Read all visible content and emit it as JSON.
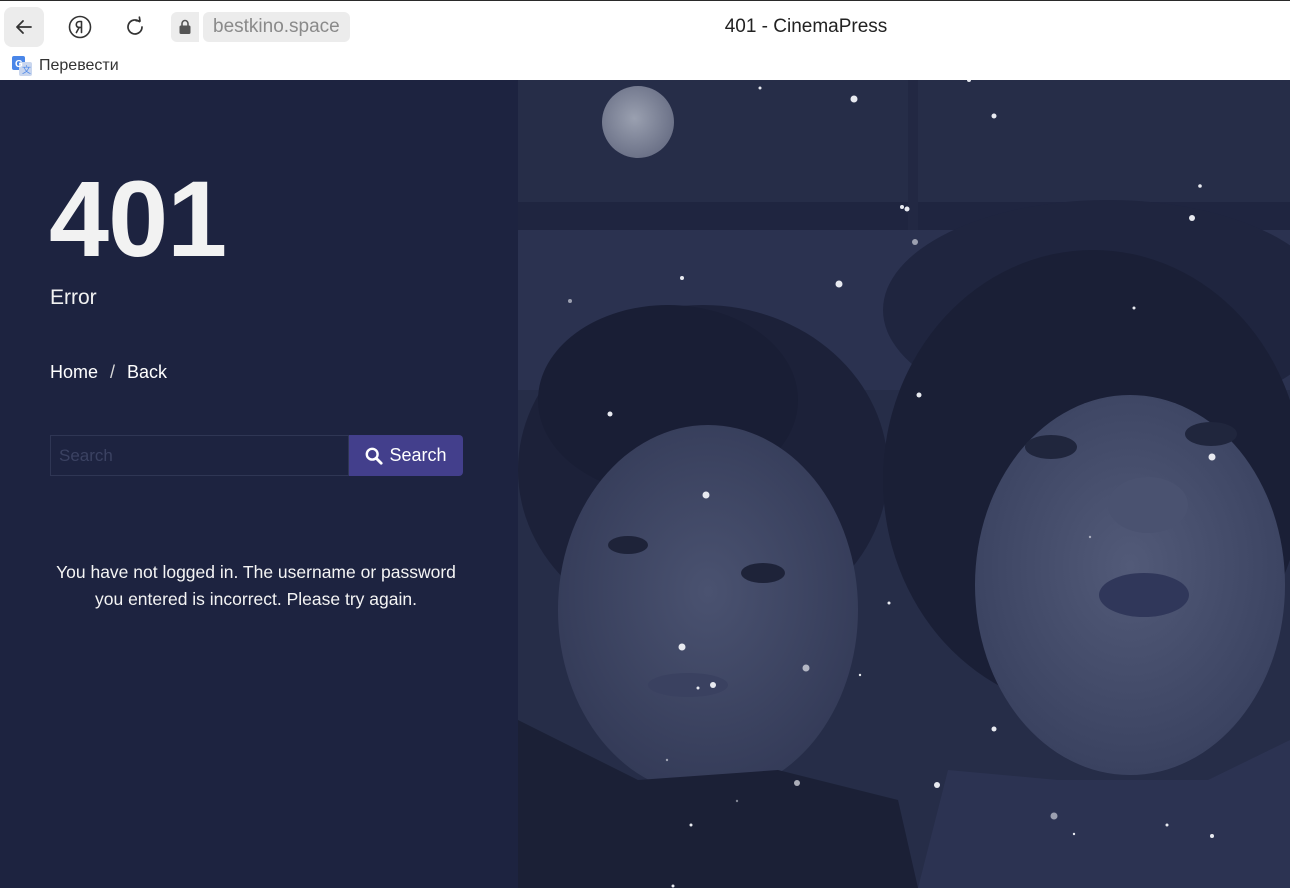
{
  "browser": {
    "url": "bestkino.space",
    "tab_title": "401 - CinemaPress",
    "translate_label": "Перевести"
  },
  "error": {
    "code": "401",
    "label": "Error",
    "message": "You have not logged in. The username or password you entered is incorrect. Please try again."
  },
  "breadcrumbs": {
    "home": "Home",
    "separator": "/",
    "back": "Back"
  },
  "search": {
    "placeholder": "Search",
    "button_label": "Search"
  },
  "colors": {
    "background": "#1d2340",
    "button": "#433f8c",
    "text": "#f2f2f2"
  },
  "icons": [
    "back-arrow-icon",
    "yandex-icon",
    "reload-icon",
    "lock-icon",
    "translate-icon",
    "search-icon"
  ]
}
